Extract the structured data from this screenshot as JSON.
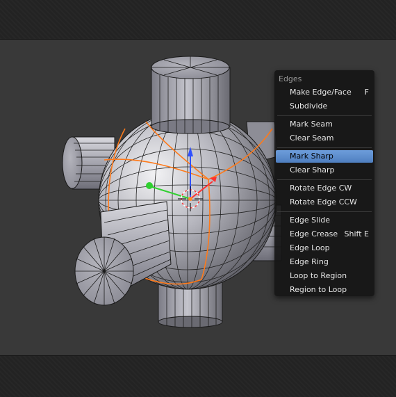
{
  "menu": {
    "title": "Edges",
    "items": [
      {
        "label": "Make Edge/Face",
        "shortcut": "F"
      },
      {
        "label": "Subdivide",
        "shortcut": ""
      },
      {
        "label": "Mark Seam",
        "shortcut": ""
      },
      {
        "label": "Clear Seam",
        "shortcut": ""
      },
      {
        "label": "Mark Sharp",
        "shortcut": "",
        "active": true
      },
      {
        "label": "Clear Sharp",
        "shortcut": ""
      },
      {
        "label": "Rotate Edge CW",
        "shortcut": ""
      },
      {
        "label": "Rotate Edge CCW",
        "shortcut": ""
      },
      {
        "label": "Edge Slide",
        "shortcut": ""
      },
      {
        "label": "Edge Crease",
        "shortcut": "Shift E"
      },
      {
        "label": "Edge Loop",
        "shortcut": ""
      },
      {
        "label": "Edge Ring",
        "shortcut": ""
      },
      {
        "label": "Loop to Region",
        "shortcut": ""
      },
      {
        "label": "Region to Loop",
        "shortcut": ""
      }
    ]
  },
  "colors": {
    "viewport_bg": "#393939",
    "selected_edge": "#ff7a1a",
    "menu_highlight": "#5b8ed0",
    "gizmo_x": "#ff3030",
    "gizmo_y": "#30d030",
    "gizmo_z": "#3050ff"
  },
  "icons": [
    "transform-gizmo-icon",
    "3d-cursor-icon"
  ]
}
